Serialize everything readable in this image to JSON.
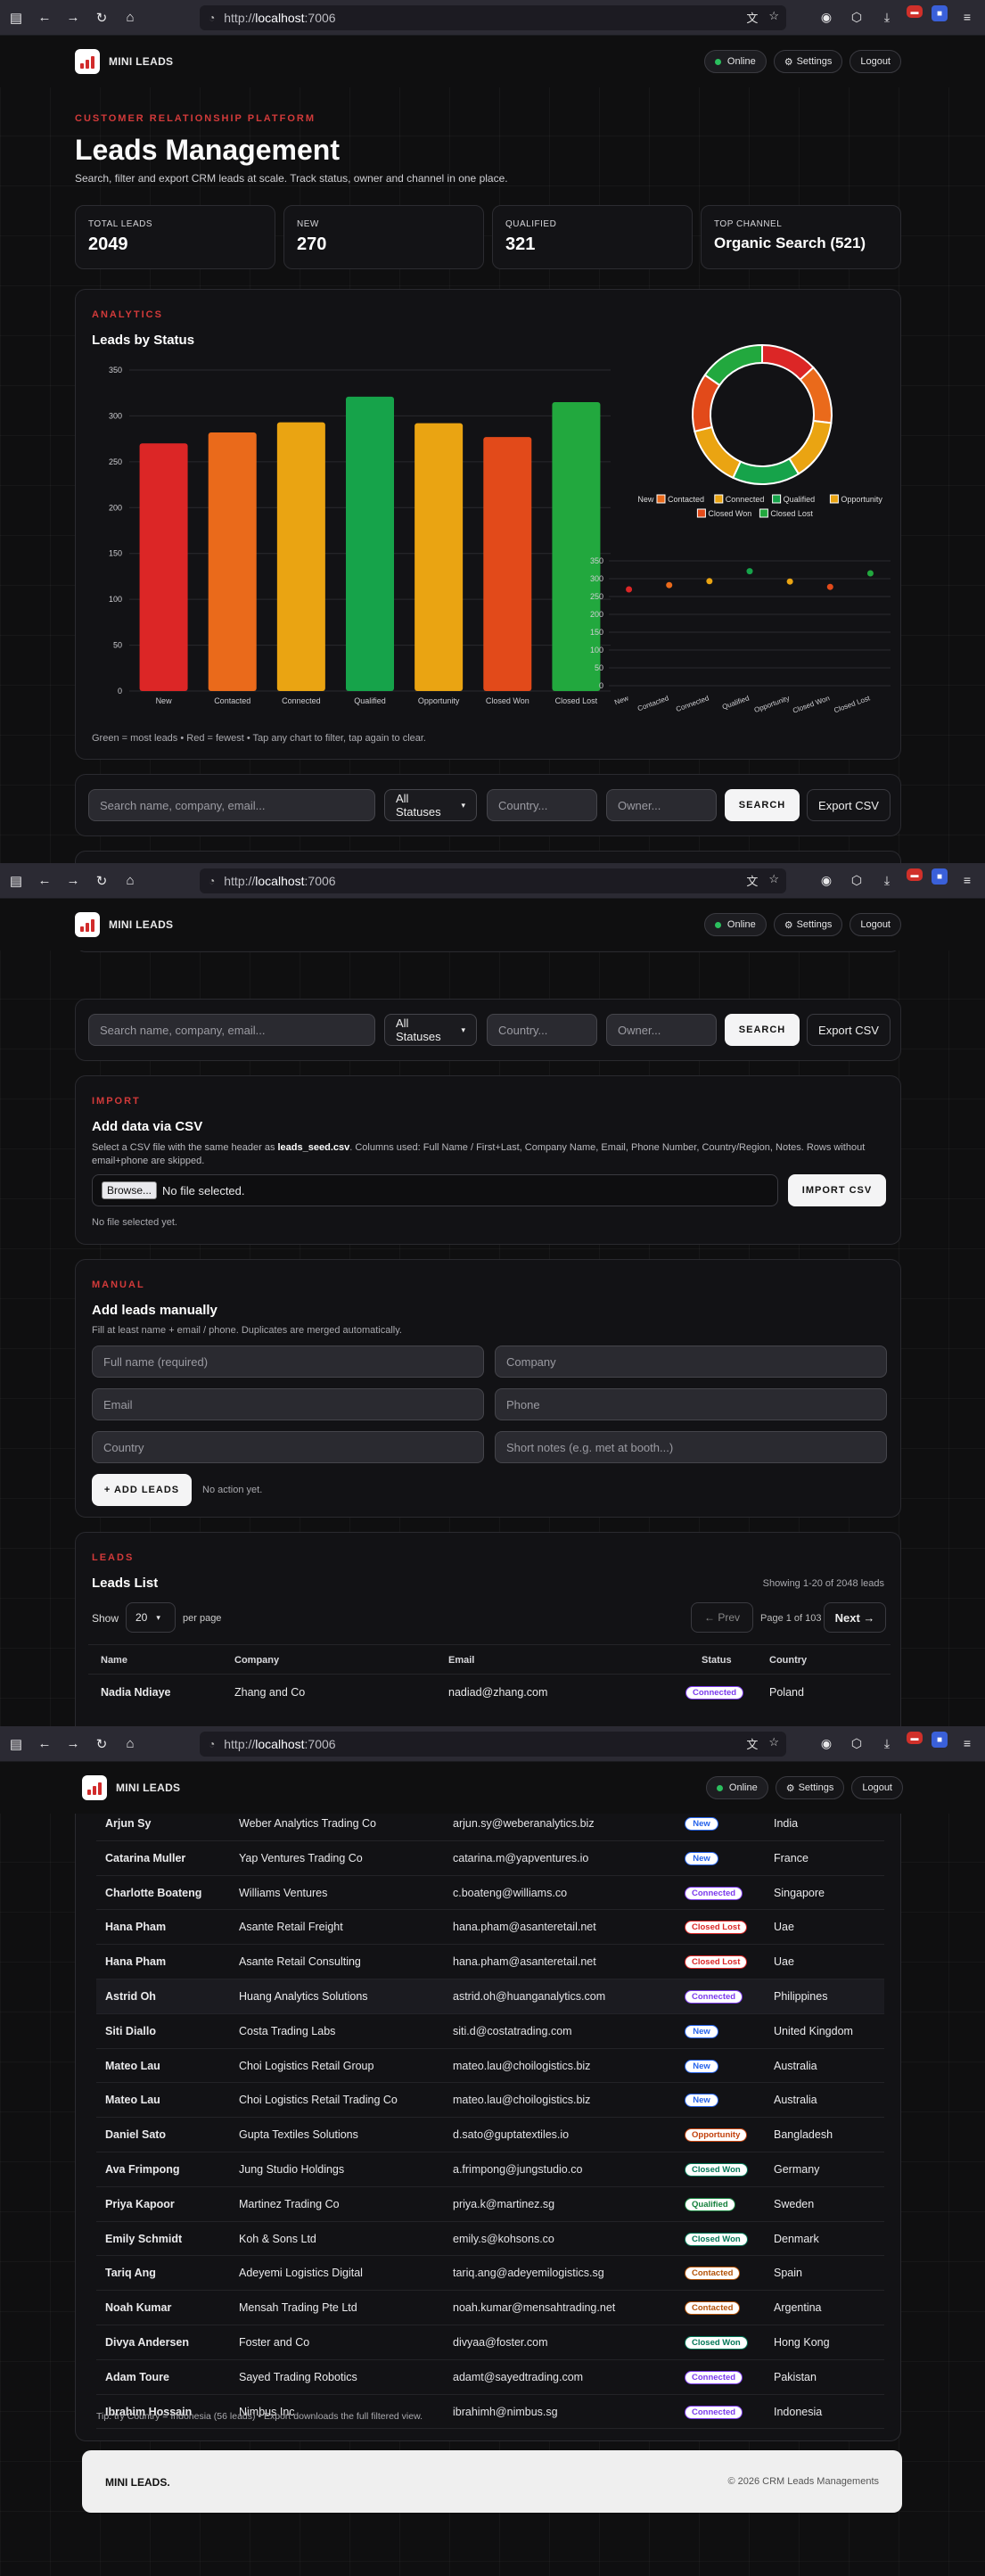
{
  "browser": {
    "url_prefix": "http://",
    "url_host": "localhost",
    "url_port": ":7006"
  },
  "nav": {
    "brand": "MINI LEADS",
    "online": "Online",
    "settings": "Settings",
    "logout": "Logout",
    "settings_icon": "gear-icon"
  },
  "hero": {
    "kicker": "CUSTOMER RELATIONSHIP PLATFORM",
    "title": "Leads Management",
    "subtitle": "Search, filter and export CRM leads at scale. Track status, owner and channel in one place."
  },
  "stats": [
    {
      "label": "TOTAL LEADS",
      "value": "2049"
    },
    {
      "label": "NEW",
      "value": "270"
    },
    {
      "label": "QUALIFIED",
      "value": "321"
    },
    {
      "label": "TOP CHANNEL",
      "value": "Organic Search (521)"
    }
  ],
  "analytics": {
    "kicker": "ANALYTICS",
    "title": "Leads by Status",
    "caption": "Green = most leads • Red = fewest • Tap any chart to filter, tap again to clear."
  },
  "chart_data": [
    {
      "type": "bar",
      "title": "Leads by Status",
      "categories": [
        "New",
        "Contacted",
        "Connected",
        "Qualified",
        "Opportunity",
        "Closed Won",
        "Closed Lost"
      ],
      "values": [
        270,
        282,
        293,
        321,
        292,
        277,
        315
      ],
      "colors": [
        "#dc2626",
        "#ea6a1b",
        "#eaa412",
        "#16a34a",
        "#eaa412",
        "#e24a1a",
        "#22a83e"
      ],
      "ylim": [
        0,
        350
      ],
      "yticks": [
        0,
        50,
        100,
        150,
        200,
        250,
        300,
        350
      ],
      "grid": true
    },
    {
      "type": "pie",
      "donut": true,
      "categories": [
        "New",
        "Contacted",
        "Connected",
        "Qualified",
        "Opportunity",
        "Closed Won",
        "Closed Lost"
      ],
      "values": [
        270,
        282,
        293,
        321,
        292,
        277,
        315
      ],
      "colors": [
        "#dc2626",
        "#ea6a1b",
        "#eaa412",
        "#16a34a",
        "#eaa412",
        "#e24a1a",
        "#22a83e"
      ],
      "legend": "bottom"
    },
    {
      "type": "scatter",
      "categories": [
        "New",
        "Contacted",
        "Connected",
        "Qualified",
        "Opportunity",
        "Closed Won",
        "Closed Lost"
      ],
      "values": [
        270,
        282,
        293,
        321,
        292,
        277,
        315
      ],
      "colors": [
        "#dc2626",
        "#ea6a1b",
        "#eaa412",
        "#16a34a",
        "#eaa412",
        "#e24a1a",
        "#22a83e"
      ],
      "ylim": [
        0,
        350
      ],
      "yticks": [
        0,
        50,
        100,
        150,
        200,
        250,
        300,
        350
      ],
      "grid": true
    }
  ],
  "filters": {
    "search_placeholder": "Search name, company, email...",
    "status_value": "All Statuses",
    "country_placeholder": "Country...",
    "owner_placeholder": "Owner...",
    "search_button": "SEARCH",
    "export_button": "Export CSV"
  },
  "import": {
    "kicker": "IMPORT",
    "title": "Add data via CSV",
    "desc_before": "Select a CSV file with the same header as ",
    "desc_file": "leads_seed.csv",
    "desc_after": ". Columns used: Full Name / First+Last, Company Name, Email, Phone Number, Country/Region, Notes. Rows without",
    "desc_line2": "email+phone are skipped.",
    "browse": "Browse...",
    "no_file": "No file selected.",
    "import_button": "IMPORT CSV",
    "status": "No file selected yet."
  },
  "manual": {
    "kicker": "MANUAL",
    "title": "Add leads manually",
    "desc": "Fill at least name + email / phone. Duplicates are merged automatically.",
    "fullname_placeholder": "Full name (required)",
    "company_placeholder": "Company",
    "email_placeholder": "Email",
    "phone_placeholder": "Phone",
    "country_placeholder": "Country",
    "notes_placeholder": "Short notes (e.g. met at booth...)",
    "add_button": "+ ADD LEADS",
    "status": "No action yet."
  },
  "leads": {
    "kicker": "LEADS",
    "title": "Leads List",
    "showing": "Showing 1-20 of 2048 leads",
    "show_label": "Show",
    "per_page_value": "20",
    "per_page_label": "per page",
    "prev": "← Prev",
    "page_info": "Page 1 of 103",
    "next": "Next →",
    "columns": [
      "Name",
      "Company",
      "Email",
      "Status",
      "Country"
    ],
    "first_row": {
      "name": "Nadia Ndiaye",
      "company": "Zhang and Co",
      "email": "nadiad@zhang.com",
      "status": "Connected",
      "country": "Poland"
    },
    "rows": [
      {
        "name": "Arjun Sy",
        "company": "Weber Analytics Trading Co",
        "email": "arjun.sy@weberanalytics.biz",
        "status": "New",
        "country": "India"
      },
      {
        "name": "Catarina Muller",
        "company": "Yap Ventures Trading Co",
        "email": "catarina.m@yapventures.io",
        "status": "New",
        "country": "France"
      },
      {
        "name": "Charlotte Boateng",
        "company": "Williams Ventures",
        "email": "c.boateng@williams.co",
        "status": "Connected",
        "country": "Singapore"
      },
      {
        "name": "Hana Pham",
        "company": "Asante Retail Freight",
        "email": "hana.pham@asanteretail.net",
        "status": "Closed Lost",
        "country": "Uae"
      },
      {
        "name": "Hana Pham",
        "company": "Asante Retail Consulting",
        "email": "hana.pham@asanteretail.net",
        "status": "Closed Lost",
        "country": "Uae"
      },
      {
        "name": "Astrid Oh",
        "company": "Huang Analytics Solutions",
        "email": "astrid.oh@huanganalytics.com",
        "status": "Connected",
        "country": "Philippines"
      },
      {
        "name": "Siti Diallo",
        "company": "Costa Trading Labs",
        "email": "siti.d@costatrading.com",
        "status": "New",
        "country": "United Kingdom"
      },
      {
        "name": "Mateo Lau",
        "company": "Choi Logistics Retail Group",
        "email": "mateo.lau@choilogistics.biz",
        "status": "New",
        "country": "Australia"
      },
      {
        "name": "Mateo Lau",
        "company": "Choi Logistics Retail Trading Co",
        "email": "mateo.lau@choilogistics.biz",
        "status": "New",
        "country": "Australia"
      },
      {
        "name": "Daniel Sato",
        "company": "Gupta Textiles Solutions",
        "email": "d.sato@guptatextiles.io",
        "status": "Opportunity",
        "country": "Bangladesh"
      },
      {
        "name": "Ava Frimpong",
        "company": "Jung Studio Holdings",
        "email": "a.frimpong@jungstudio.co",
        "status": "Closed Won",
        "country": "Germany"
      },
      {
        "name": "Priya Kapoor",
        "company": "Martinez Trading Co",
        "email": "priya.k@martinez.sg",
        "status": "Qualified",
        "country": "Sweden"
      },
      {
        "name": "Emily Schmidt",
        "company": "Koh & Sons Ltd",
        "email": "emily.s@kohsons.co",
        "status": "Closed Won",
        "country": "Denmark"
      },
      {
        "name": "Tariq Ang",
        "company": "Adeyemi Logistics Digital",
        "email": "tariq.ang@adeyemilogistics.sg",
        "status": "Contacted",
        "country": "Spain"
      },
      {
        "name": "Noah Kumar",
        "company": "Mensah Trading Pte Ltd",
        "email": "noah.kumar@mensahtrading.net",
        "status": "Contacted",
        "country": "Argentina"
      },
      {
        "name": "Divya Andersen",
        "company": "Foster and Co",
        "email": "divyaa@foster.com",
        "status": "Closed Won",
        "country": "Hong Kong"
      },
      {
        "name": "Adam Toure",
        "company": "Sayed Trading Robotics",
        "email": "adamt@sayedtrading.com",
        "status": "Connected",
        "country": "Pakistan"
      },
      {
        "name": "Ibrahim Hossain",
        "company": "Nimbus Inc",
        "email": "ibrahimh@nimbus.sg",
        "status": "Connected",
        "country": "Indonesia"
      }
    ],
    "tip": "Tip: try Country = Indonesia (56 leads) • Export downloads the full filtered view."
  },
  "status_colors": {
    "New": "#2563eb",
    "Contacted": "#b45309",
    "Connected": "#7c3aed",
    "Qualified": "#15803d",
    "Opportunity": "#c2410c",
    "Closed Won": "#047857",
    "Closed Lost": "#dc2626"
  },
  "footer": {
    "brand": "MINI LEADS.",
    "copyright": "© 2026 CRM Leads Managements"
  }
}
